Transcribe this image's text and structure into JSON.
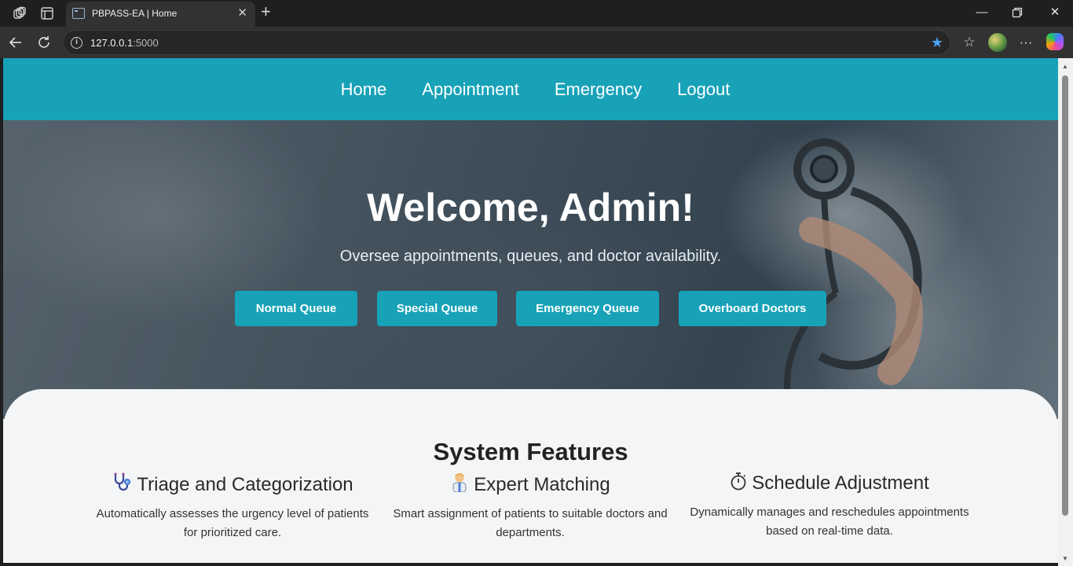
{
  "browser": {
    "tab_title": "PBPASS-EA | Home",
    "url_host": "127.0.0.1",
    "url_port": ":5000"
  },
  "nav": {
    "links": [
      "Home",
      "Appointment",
      "Emergency",
      "Logout"
    ]
  },
  "hero": {
    "title": "Welcome, Admin!",
    "subtitle": "Oversee appointments, queues, and doctor availability.",
    "buttons": [
      "Normal Queue",
      "Special Queue",
      "Emergency Queue",
      "Overboard Doctors"
    ]
  },
  "features": {
    "title": "System Features",
    "items": [
      {
        "icon": "stethoscope-icon",
        "title": "Triage and Categorization",
        "desc": "Automatically assesses the urgency level of patients for prioritized care."
      },
      {
        "icon": "doctor-icon",
        "title": "Expert Matching",
        "desc": "Smart assignment of patients to suitable doctors and departments."
      },
      {
        "icon": "stopwatch-icon",
        "title": "Schedule Adjustment",
        "desc": "Dynamically manages and reschedules appointments based on real-time data."
      }
    ]
  },
  "colors": {
    "accent": "#17a2b8",
    "page_bg": "#f3f5f6"
  }
}
